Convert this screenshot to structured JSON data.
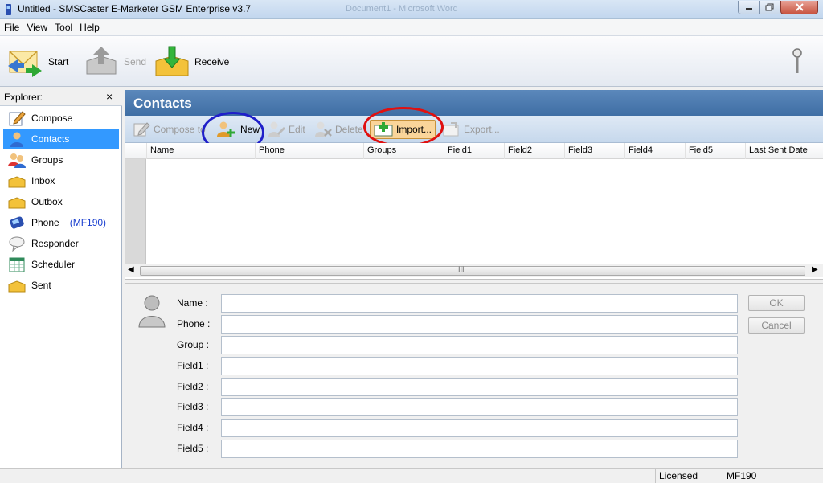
{
  "window": {
    "title": "Untitled - SMSCaster E-Marketer GSM Enterprise v3.7",
    "background_title": "Document1 - Microsoft Word"
  },
  "menu": [
    "File",
    "View",
    "Tool",
    "Help"
  ],
  "toolbar": {
    "start": "Start",
    "send": "Send",
    "receive": "Receive"
  },
  "explorer": {
    "title": "Explorer:",
    "close": "×",
    "items": [
      {
        "label": "Compose",
        "icon": "compose-icon"
      },
      {
        "label": "Contacts",
        "icon": "contacts-icon",
        "selected": true
      },
      {
        "label": "Groups",
        "icon": "groups-icon"
      },
      {
        "label": "Inbox",
        "icon": "inbox-icon"
      },
      {
        "label": "Outbox",
        "icon": "outbox-icon"
      },
      {
        "label": "Phone",
        "icon": "phone-icon",
        "extra": "(MF190)"
      },
      {
        "label": "Responder",
        "icon": "responder-icon"
      },
      {
        "label": "Scheduler",
        "icon": "scheduler-icon"
      },
      {
        "label": "Sent",
        "icon": "sent-icon"
      }
    ]
  },
  "contacts": {
    "title": "Contacts",
    "actions": {
      "compose_to": "Compose to",
      "new": "New",
      "edit": "Edit",
      "delete": "Delete",
      "import": "Import...",
      "export": "Export..."
    },
    "columns": [
      "Name",
      "Phone",
      "Groups",
      "Field1",
      "Field2",
      "Field3",
      "Field4",
      "Field5",
      "Last Sent Date"
    ],
    "scroll_grip": "III"
  },
  "form": {
    "labels": [
      "Name :",
      "Phone :",
      "Group :",
      "Field1 :",
      "Field2 :",
      "Field3 :",
      "Field4 :",
      "Field5 :"
    ],
    "values": [
      "",
      "",
      "",
      "",
      "",
      "",
      "",
      ""
    ],
    "ok": "OK",
    "cancel": "Cancel"
  },
  "status": {
    "license": "Licensed",
    "device": "MF190"
  },
  "colors": {
    "selection": "#3399ff",
    "header": "#4a78ad",
    "annotation_blue": "#1f1fc9",
    "annotation_red": "#e01010"
  }
}
